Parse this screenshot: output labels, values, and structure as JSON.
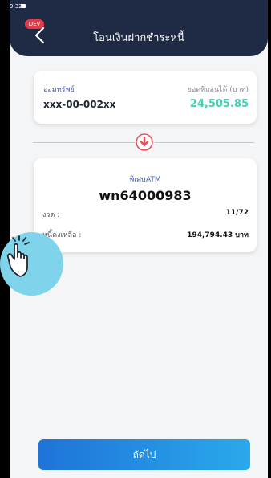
{
  "status_bar": {
    "time": "9:32"
  },
  "header": {
    "badge": "DEV",
    "title": "โอนเงินฝากชำระหนี้"
  },
  "source_card": {
    "account_label": "ออมทรัพย์",
    "available_label": "ยอดที่ถอนได้ (บาท)",
    "account_number": "xxx-00-002xx",
    "amount": "24,505.85"
  },
  "destination_card": {
    "type": "พิเศษATM",
    "number": "wn64000983",
    "rows": [
      {
        "label": "งวด :",
        "value": "11/72"
      },
      {
        "label": "หนี้คงเหลือ :",
        "value": "194,794.43 บาท"
      }
    ]
  },
  "next_button": {
    "label": "ถัดไป"
  },
  "colors": {
    "header_bg": "#1f2a44",
    "accent_blue": "#3f5fb0",
    "amount_teal": "#3fd3b5",
    "button_start": "#1e73d8",
    "button_end": "#2aa9ec",
    "arrow_red": "#e84b5a"
  },
  "icons": [
    "back-arrow-icon",
    "down-arrow-icon",
    "tap-hand-icon"
  ]
}
